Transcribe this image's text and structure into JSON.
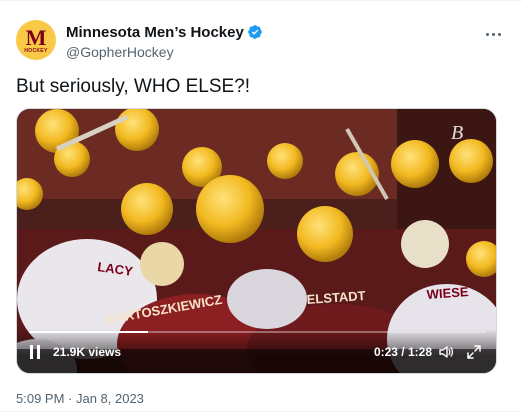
{
  "author": {
    "name": "Minnesota Men’s Hockey",
    "handle": "@GopherHockey",
    "avatar_logo_letter": "M",
    "avatar_logo_word": "HOCKEY",
    "verified_icon": "verified-badge-icon"
  },
  "tweet": {
    "text": "But seriously, WHO ELSE?!",
    "timestamp": "5:09 PM · Jan 8, 2023"
  },
  "video": {
    "views": "21.9K views",
    "time": "0:23 / 1:28",
    "progress_fraction": 0.26,
    "icons": [
      "pause-icon",
      "volume-icon",
      "fullscreen-icon"
    ]
  },
  "colors": {
    "gopher_maroon": "#7a0019",
    "gopher_gold": "#f9c846",
    "verified_blue": "#1d9bf0",
    "secondary_text": "#536471"
  }
}
